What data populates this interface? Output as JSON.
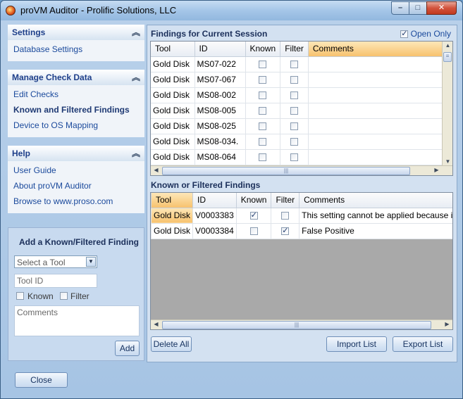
{
  "window": {
    "title": "proVM Auditor - Prolific Solutions, LLC"
  },
  "caption": {
    "minimize": "–",
    "maximize": "□",
    "close": "✕"
  },
  "sidebar": {
    "settings": {
      "title": "Settings",
      "items": [
        "Database Settings"
      ]
    },
    "manage": {
      "title": "Manage Check Data",
      "items": [
        "Edit Checks",
        "Known and Filtered Findings",
        "Device to OS Mapping"
      ]
    },
    "help": {
      "title": "Help",
      "items": [
        "User Guide",
        "About proVM Auditor",
        "Browse to www.proso.com"
      ]
    },
    "collapse_glyph": "︽"
  },
  "add_finding": {
    "title": "Add a Known/Filtered Finding",
    "tool_placeholder": "Select a Tool",
    "tool_id_placeholder": "Tool ID",
    "known_label": "Known",
    "filter_label": "Filter",
    "comments_placeholder": "Comments",
    "add_label": "Add"
  },
  "current_session": {
    "title": "Findings for Current Session",
    "open_only_label": "Open Only",
    "open_only_checked": true,
    "columns": [
      "Tool",
      "ID",
      "Known",
      "Filter",
      "Comments"
    ],
    "rows": [
      {
        "tool": "Gold Disk",
        "id": "MS07-022",
        "known": false,
        "filter": false,
        "comments": ""
      },
      {
        "tool": "Gold Disk",
        "id": "MS07-067",
        "known": false,
        "filter": false,
        "comments": ""
      },
      {
        "tool": "Gold Disk",
        "id": "MS08-002",
        "known": false,
        "filter": false,
        "comments": ""
      },
      {
        "tool": "Gold Disk",
        "id": "MS08-005",
        "known": false,
        "filter": false,
        "comments": ""
      },
      {
        "tool": "Gold Disk",
        "id": "MS08-025",
        "known": false,
        "filter": false,
        "comments": ""
      },
      {
        "tool": "Gold Disk",
        "id": "MS08-034.",
        "known": false,
        "filter": false,
        "comments": ""
      },
      {
        "tool": "Gold Disk",
        "id": "MS08-064",
        "known": false,
        "filter": false,
        "comments": ""
      }
    ]
  },
  "known_filtered": {
    "title": "Known or Filtered Findings",
    "columns": [
      "Tool",
      "ID",
      "Known",
      "Filter",
      "Comments"
    ],
    "rows": [
      {
        "tool": "Gold Disk",
        "id": "V0003383",
        "known": true,
        "filter": false,
        "comments": "This setting cannot be applied because it w..."
      },
      {
        "tool": "Gold Disk",
        "id": "V0003384",
        "known": false,
        "filter": true,
        "comments": "False Positive"
      }
    ]
  },
  "buttons": {
    "delete_all": "Delete All",
    "import_list": "Import List",
    "export_list": "Export List",
    "close": "Close"
  },
  "colors": {
    "accent": "#f7c26e",
    "link": "#1b4a9c",
    "frame": "#a6c4e4"
  }
}
